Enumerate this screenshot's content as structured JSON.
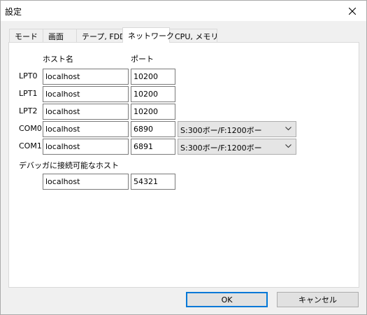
{
  "window": {
    "title": "設定"
  },
  "tabs": [
    {
      "label": "モード"
    },
    {
      "label": "画面"
    },
    {
      "label": "テープ, FDD"
    },
    {
      "label": "ネットワーク"
    },
    {
      "label": "CPU, メモリ"
    }
  ],
  "active_tab": "ネットワーク",
  "headers": {
    "host": "ホスト名",
    "port": "ポート"
  },
  "rows": [
    {
      "label": "LPT0",
      "host": "localhost",
      "port": "10200"
    },
    {
      "label": "LPT1",
      "host": "localhost",
      "port": "10200"
    },
    {
      "label": "LPT2",
      "host": "localhost",
      "port": "10200"
    },
    {
      "label": "COM0",
      "host": "localhost",
      "port": "6890",
      "speed": "S:300ボー/F:1200ボー"
    },
    {
      "label": "COM1",
      "host": "localhost",
      "port": "6891",
      "speed": "S:300ボー/F:1200ボー"
    }
  ],
  "debugger": {
    "label": "デバッガに接続可能なホスト",
    "host": "localhost",
    "port": "54321"
  },
  "buttons": {
    "ok": "OK",
    "cancel": "キャンセル"
  },
  "icons": {
    "close": "close-icon",
    "dropdown": "chevron-down-icon"
  }
}
